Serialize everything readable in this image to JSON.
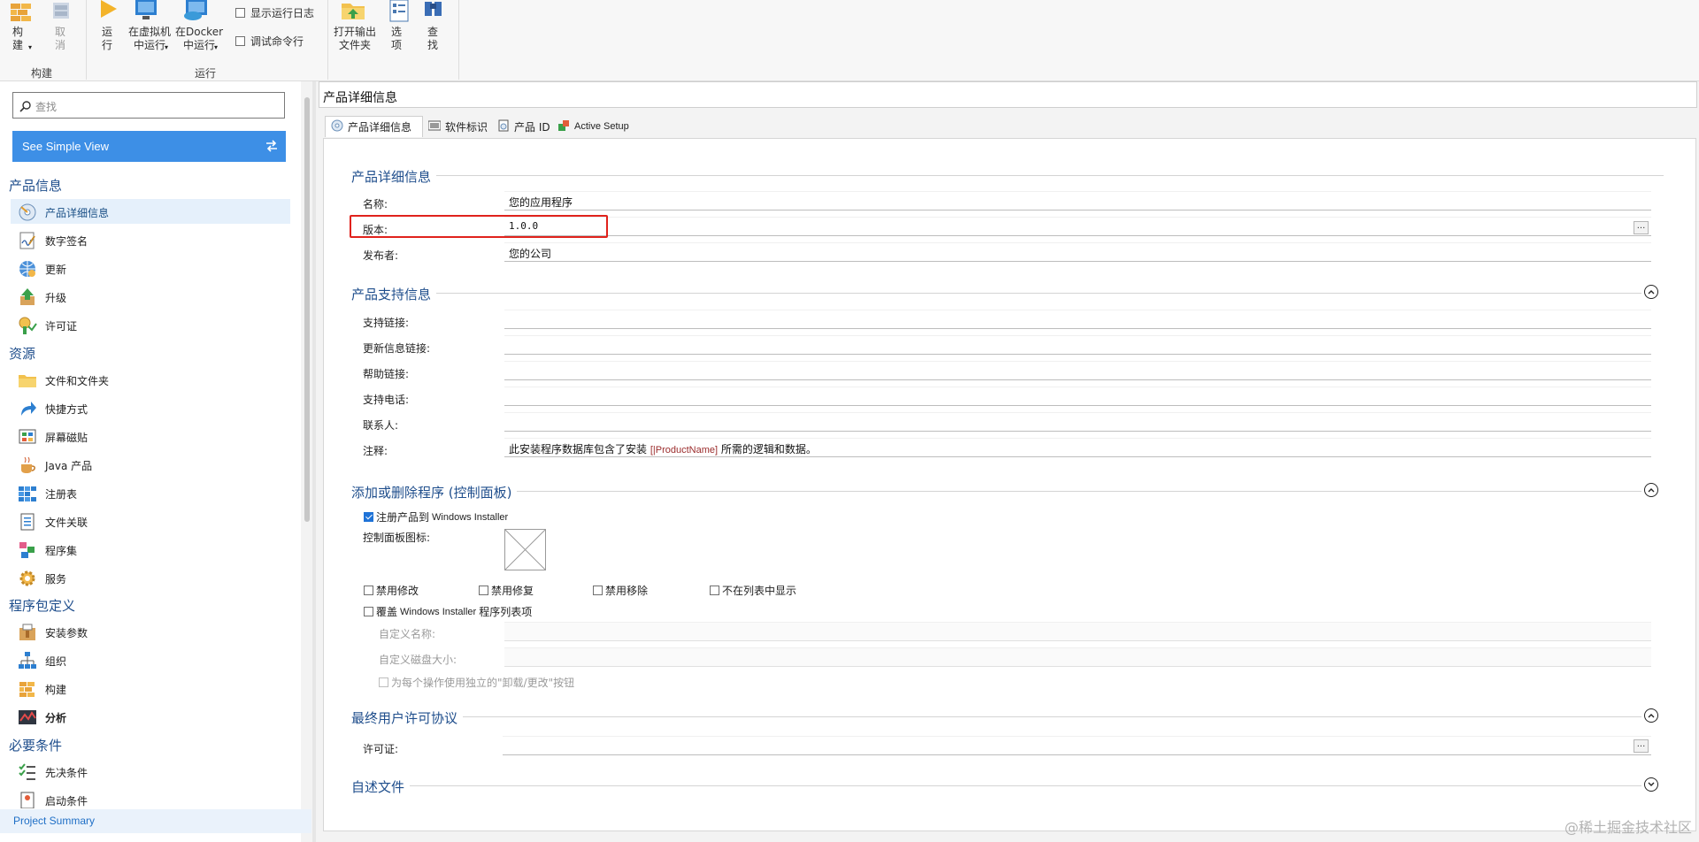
{
  "ribbon": {
    "build_group": {
      "label": "构建",
      "build": "构\n建",
      "cancel": "取\n消"
    },
    "run_group": {
      "label": "运行",
      "run": "运\n行",
      "run_vm": "在虚拟机\n中运行",
      "run_docker": "在Docker\n中运行",
      "show_log": "显示运行日志",
      "debug_cmd": "调试命令行"
    },
    "open_output": "打开输出\n文件夹",
    "options": "选\n项",
    "find": "查\n找"
  },
  "sidebar": {
    "search_placeholder": "查找",
    "simple_view": "See Simple View",
    "categories": {
      "product_info": "产品信息",
      "resources": "资源",
      "package_def": "程序包定义",
      "requirements": "必要条件"
    },
    "items": {
      "product_details": "产品详细信息",
      "digital_sign": "数字签名",
      "updates": "更新",
      "upgrades": "升级",
      "license": "许可证",
      "files": "文件和文件夹",
      "shortcuts": "快捷方式",
      "tiles": "屏幕磁贴",
      "java": "Java 产品",
      "registry": "注册表",
      "file_assoc": "文件关联",
      "assemblies": "程序集",
      "services": "服务",
      "install_params": "安装参数",
      "organization": "组织",
      "build": "构建",
      "analytics": "分析",
      "prerequisites": "先决条件",
      "launch_conditions": "启动条件"
    },
    "project_summary": "Project Summary"
  },
  "main": {
    "title": "产品详细信息",
    "tabs": {
      "details": "产品详细信息",
      "software_id": "软件标识",
      "product_id": "产品 ID",
      "active_setup": "Active Setup"
    },
    "section_details": {
      "title": "产品详细信息",
      "name_label": "名称:",
      "name_value": "您的应用程序",
      "version_label": "版本:",
      "version_value": "1.0.0",
      "publisher_label": "发布者:",
      "publisher_value": "您的公司"
    },
    "section_support": {
      "title": "产品支持信息",
      "support_link": "支持链接:",
      "update_link": "更新信息链接:",
      "help_link": "帮助链接:",
      "support_phone": "支持电话:",
      "contact": "联系人:",
      "comments": "注释:",
      "comments_before": "此安装程序数据库包含了安装",
      "comments_prop": "[|ProductName]",
      "comments_after": "所需的逻辑和数据。"
    },
    "section_arp": {
      "title": "添加或删除程序 (控制面板)",
      "register": "注册产品到",
      "register_en": "Windows Installer",
      "cp_icon": "控制面板图标:",
      "disable_modify": "禁用修改",
      "disable_repair": "禁用修复",
      "disable_remove": "禁用移除",
      "hide_in_list": "不在列表中显示",
      "override": "覆盖",
      "override_en": "Windows Installer",
      "override_tail": "程序列表项",
      "custom_name": "自定义名称:",
      "custom_size": "自定义磁盘大小:",
      "separate_buttons": "为每个操作使用独立的\"卸载/更改\"按钮"
    },
    "section_eula": {
      "title": "最终用户许可协议",
      "license_label": "许可证:"
    },
    "section_readme": {
      "title": "自述文件"
    },
    "ellipsis": "..."
  },
  "watermark": "@稀土掘金技术社区"
}
